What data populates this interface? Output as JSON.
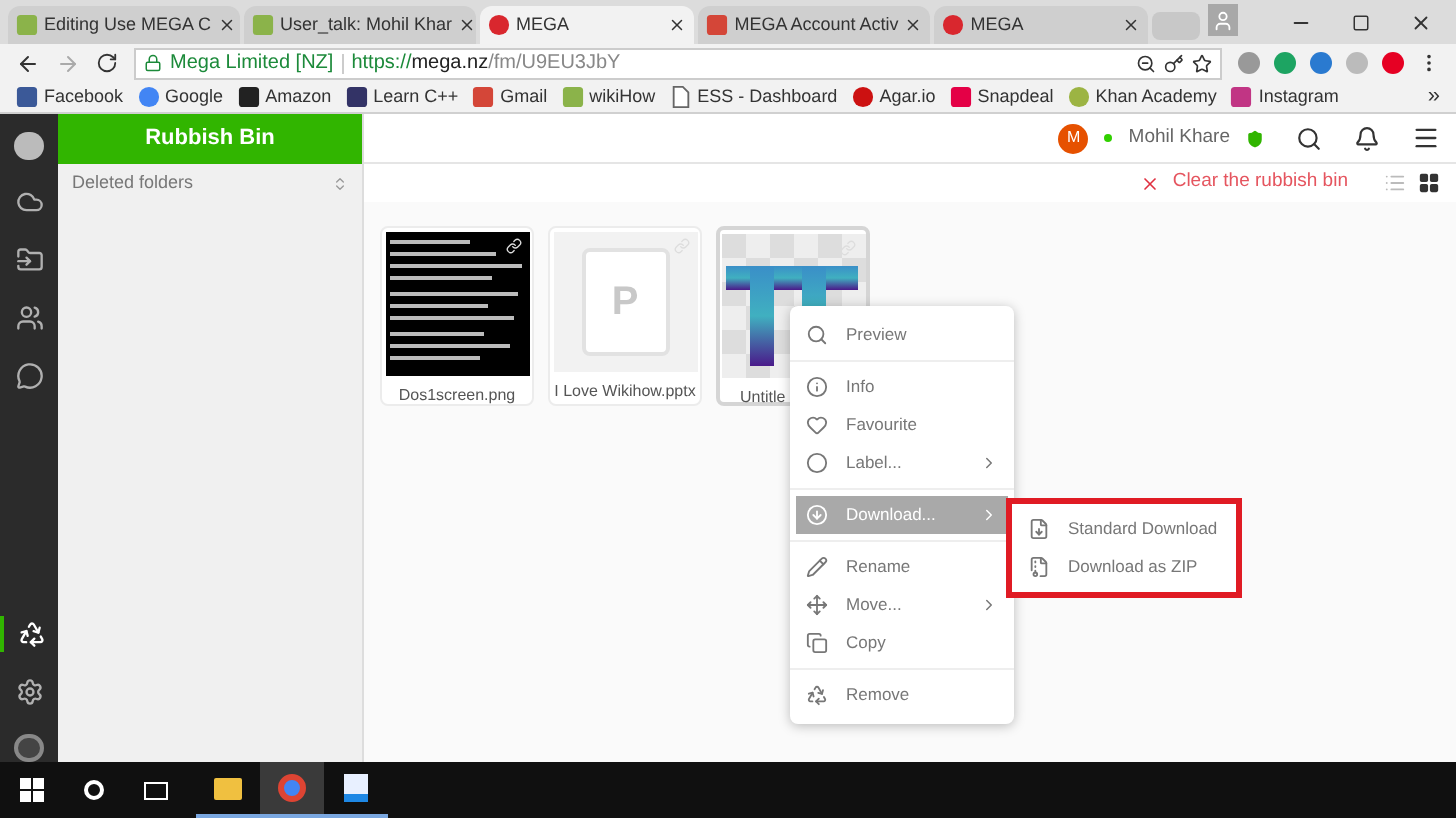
{
  "browser": {
    "tabs": [
      {
        "title": "Editing Use MEGA C",
        "kind": "wikihow",
        "selected": false
      },
      {
        "title": "User_talk: Mohil Khar",
        "kind": "wikihow",
        "selected": false
      },
      {
        "title": "MEGA",
        "kind": "mega",
        "selected": true
      },
      {
        "title": "MEGA Account Activ",
        "kind": "gmail",
        "selected": false
      },
      {
        "title": "MEGA",
        "kind": "mega",
        "selected": false
      }
    ],
    "address": {
      "security_label": "Mega Limited [NZ]",
      "scheme": "https://",
      "host": "mega.nz",
      "path": "/fm/U9EU3JbY"
    },
    "bookmarks": [
      {
        "label": "Facebook",
        "kind": "facebook"
      },
      {
        "label": "Google",
        "kind": "google"
      },
      {
        "label": "Amazon",
        "kind": "amazon"
      },
      {
        "label": "Learn C++",
        "kind": "learncpp"
      },
      {
        "label": "Gmail",
        "kind": "gmail"
      },
      {
        "label": "wikiHow",
        "kind": "wikihow"
      },
      {
        "label": "ESS - Dashboard",
        "kind": "page"
      },
      {
        "label": "Agar.io",
        "kind": "agar"
      },
      {
        "label": "Snapdeal",
        "kind": "snapdeal"
      },
      {
        "label": "Khan Academy",
        "kind": "khan"
      },
      {
        "label": "Instagram",
        "kind": "instagram"
      }
    ],
    "bookmarks_more": "»"
  },
  "app": {
    "nav": [
      {
        "kind": "cloud",
        "selected": false
      },
      {
        "kind": "inbox",
        "selected": false
      },
      {
        "kind": "contacts",
        "selected": false
      },
      {
        "kind": "chat",
        "selected": false
      },
      {
        "kind": "rubbish",
        "selected": true
      },
      {
        "kind": "settings",
        "selected": false
      }
    ],
    "panel_title": "Rubbish Bin",
    "tree_header": "Deleted folders",
    "user": {
      "initial": "M",
      "name": "Mohil Khare",
      "online": true
    },
    "clear_action": "Clear the rubbish bin",
    "views": [
      {
        "kind": "list",
        "selected": false
      },
      {
        "kind": "grid",
        "selected": true
      }
    ],
    "files": [
      {
        "name": "Dos1screen.png",
        "kind": "screenshot",
        "selected": false
      },
      {
        "name": "I Love Wikihow.pptx",
        "kind": "document",
        "letter": "P",
        "selected": false
      },
      {
        "name": "Untitle",
        "kind": "logo",
        "selected": true
      }
    ],
    "context_menu": {
      "groups": [
        [
          {
            "label": "Preview",
            "kind": "preview",
            "submenu": false,
            "selected": false
          }
        ],
        [
          {
            "label": "Info",
            "kind": "info",
            "submenu": false,
            "selected": false
          },
          {
            "label": "Favourite",
            "kind": "heart",
            "submenu": false,
            "selected": false
          },
          {
            "label": "Label...",
            "kind": "label",
            "submenu": true,
            "selected": false
          }
        ],
        [
          {
            "label": "Download...",
            "kind": "download",
            "submenu": true,
            "selected": true
          }
        ],
        [
          {
            "label": "Rename",
            "kind": "rename",
            "submenu": false,
            "selected": false
          },
          {
            "label": "Move...",
            "kind": "move",
            "submenu": true,
            "selected": false
          },
          {
            "label": "Copy",
            "kind": "copy",
            "submenu": false,
            "selected": false
          }
        ],
        [
          {
            "label": "Remove",
            "kind": "remove",
            "submenu": false,
            "selected": false
          }
        ]
      ]
    },
    "submenu": {
      "highlighted": true,
      "items": [
        {
          "label": "Standard Download",
          "kind": "standard"
        },
        {
          "label": "Download as ZIP",
          "kind": "zip"
        }
      ]
    }
  },
  "taskbar": {
    "apps": [
      {
        "kind": "explorer",
        "selected": false
      },
      {
        "kind": "chrome",
        "selected": true
      },
      {
        "kind": "photos",
        "selected": false
      }
    ]
  }
}
